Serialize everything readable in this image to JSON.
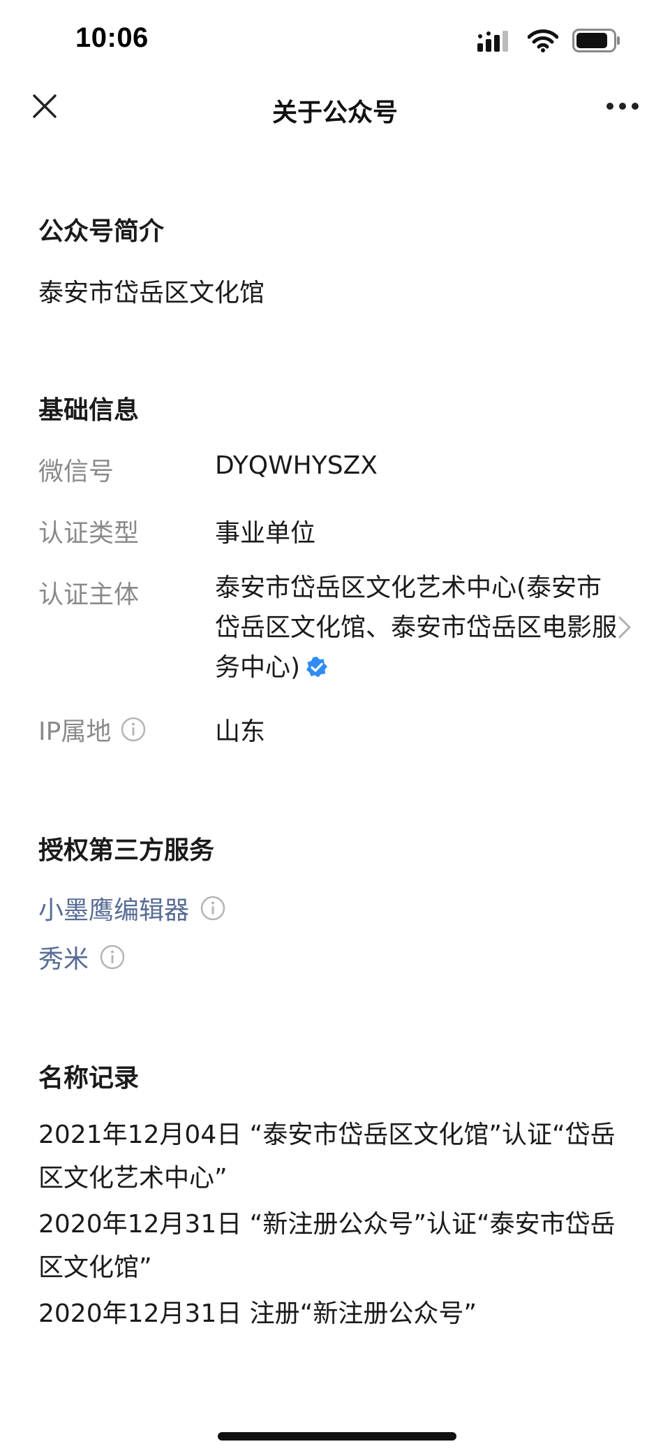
{
  "status_bar": {
    "time": "10:06",
    "icons": [
      "signal-icon",
      "wifi-icon",
      "battery-icon"
    ]
  },
  "nav": {
    "title": "关于公众号",
    "close_icon": "close-icon",
    "more_icon": "more-icon"
  },
  "intro": {
    "heading": "公众号简介",
    "text": "泰安市岱岳区文化馆"
  },
  "basic_info": {
    "heading": "基础信息",
    "wechat_id_label": "微信号",
    "wechat_id_value": "DYQWHYSZX",
    "cert_type_label": "认证类型",
    "cert_type_value": "事业单位",
    "cert_subject_label": "认证主体",
    "cert_subject_value": "泰安市岱岳区文化艺术中心(泰安市岱岳区文化馆、泰安市岱岳区电影服务中心)",
    "ip_label": "IP属地",
    "ip_value": "山东"
  },
  "third_party": {
    "heading": "授权第三方服务",
    "services": [
      "小墨鹰编辑器",
      "秀米"
    ]
  },
  "name_history": {
    "heading": "名称记录",
    "records": [
      "2021年12月04日 “泰安市岱岳区文化馆”认证“岱岳区文化艺术中心”",
      "2020年12月31日 “新注册公众号”认证“泰安市岱岳区文化馆”",
      "2020年12月31日 注册“新注册公众号”"
    ]
  },
  "colors": {
    "link": "#576b95",
    "label": "#8a8a8a",
    "verified_badge": "#2f8cf3"
  }
}
